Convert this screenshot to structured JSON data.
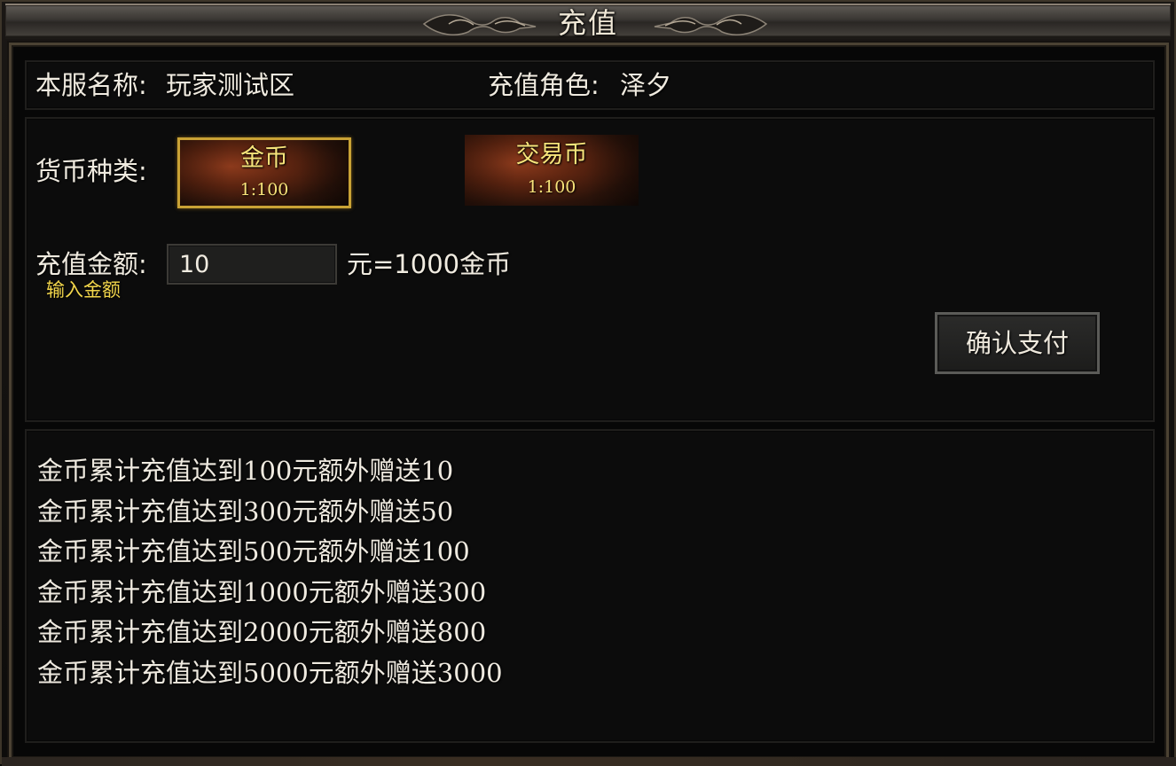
{
  "window": {
    "title": "充值"
  },
  "server": {
    "server_label": "本服名称:",
    "server_name": "玩家测试区",
    "role_label": "充值角色:",
    "role_name": "泽夕"
  },
  "currency": {
    "label": "货币种类:",
    "options": [
      {
        "name": "金币",
        "rate": "1:100",
        "selected": true
      },
      {
        "name": "交易币",
        "rate": "1:100",
        "selected": false
      }
    ]
  },
  "amount": {
    "label": "充值金额:",
    "value": "10",
    "hint": "输入金额",
    "result": "元=1000金币"
  },
  "confirm_label": "确认支付",
  "bonus_lines": [
    "金币累计充值达到100元额外赠送10",
    "金币累计充值达到300元额外赠送50",
    "金币累计充值达到500元额外赠送100",
    "金币累计充值达到1000元额外赠送300",
    "金币累计充值达到2000元额外赠送800",
    "金币累计充值达到5000元额外赠送3000"
  ],
  "colors": {
    "gold_text": "#f7e37a",
    "hint_text": "#f2d64b",
    "selected_border": "#c9a235",
    "body_text": "#f0ebe0"
  }
}
